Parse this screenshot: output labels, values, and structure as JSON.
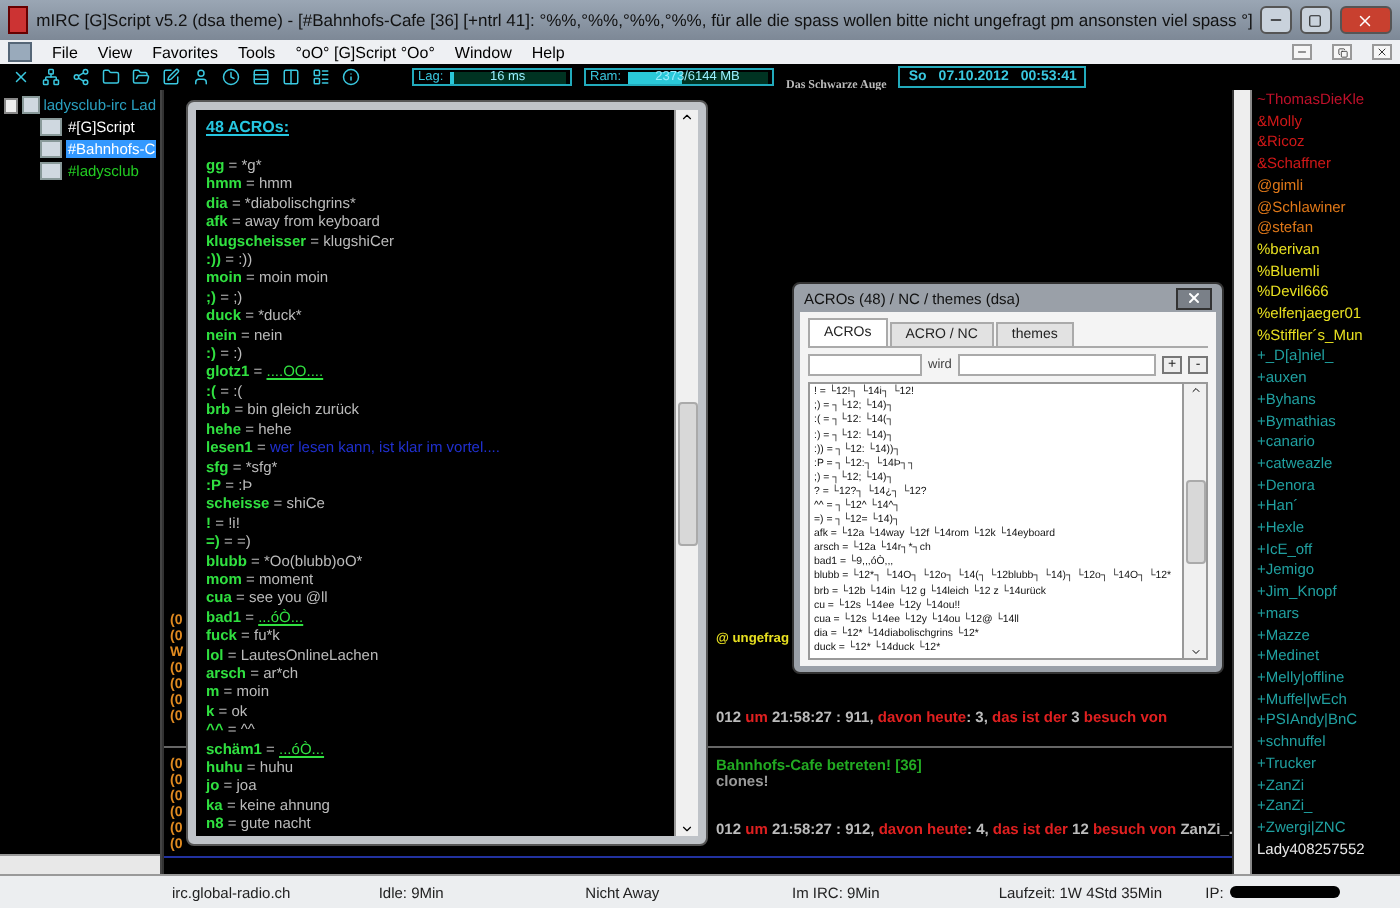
{
  "window": {
    "title": "mIRC [G]Script v5.2 (dsa theme) - [#Bahnhofs-Cafe [36] [+ntrl 41]: °%%,°%%,°%%,°%%, für alle die spass wollen bitte nicht ungefragt pm ansonsten viel spass °]"
  },
  "menu": [
    "File",
    "View",
    "Favorites",
    "Tools",
    "°oO° [G]Script °Oo°",
    "Window",
    "Help"
  ],
  "toolbar": {
    "lag": {
      "label": "Lag:",
      "reading": "16 ms",
      "level": 0.04
    },
    "ram": {
      "label": "Ram:",
      "reading": "2373/6144 MB",
      "level": 0.39
    },
    "banner": "Das Schwarze Auge",
    "clock": {
      "day": "So",
      "date": "07.10.2012",
      "time": "00:53:41"
    }
  },
  "tree": {
    "label": "ladysclub-irc Lad",
    "children": [
      {
        "label": "#[G]Script",
        "selected": false,
        "color": "#ffffff"
      },
      {
        "label": "#Bahnhofs-C",
        "selected": true
      },
      {
        "label": "#ladysclub",
        "selected": false,
        "color": "#22cc22"
      }
    ]
  },
  "chat": {
    "upper": [
      {
        "left": "(0"
      },
      {
        "left": "(0",
        "segments": [
          {
            "text": "@ ungefrag",
            "kind": "topic"
          }
        ]
      },
      {
        "left": "W"
      },
      {
        "left": "(0"
      },
      {
        "left": "(0"
      },
      {
        "left": "(0"
      },
      {
        "left": "(0",
        "segments": [
          {
            "text": "012 ",
            "kind": "plain"
          },
          {
            "text": "um",
            "kind": "hl"
          },
          {
            "text": " 21:58:27 : 911, ",
            "kind": "plain"
          },
          {
            "text": "davon heute",
            "kind": "hl"
          },
          {
            "text": ": 3, ",
            "kind": "plain"
          },
          {
            "text": "das ist der",
            "kind": "hl"
          },
          {
            "text": " 3 ",
            "kind": "plain"
          },
          {
            "text": "besuch von",
            "kind": "hl"
          }
        ]
      }
    ],
    "lower": [
      {
        "left": "(0",
        "segments": [
          {
            "text": "Bahnhofs-Cafe betreten! [36]",
            "kind": "join"
          }
        ]
      },
      {
        "left": "(0",
        "segments": [
          {
            "text": "clones!",
            "kind": "dim"
          }
        ]
      },
      {
        "left": "(0"
      },
      {
        "left": "(0"
      },
      {
        "left": "(0",
        "segments": [
          {
            "text": "012 ",
            "kind": "plain"
          },
          {
            "text": "um",
            "kind": "hl"
          },
          {
            "text": " 21:58:27 : 912, ",
            "kind": "plain"
          },
          {
            "text": "davon heute",
            "kind": "hl"
          },
          {
            "text": ": 4, ",
            "kind": "plain"
          },
          {
            "text": "das ist der",
            "kind": "hl"
          },
          {
            "text": " 12 ",
            "kind": "plain"
          },
          {
            "text": "besuch von",
            "kind": "hl"
          },
          {
            "text": " ZanZi_.",
            "kind": "plain"
          }
        ]
      },
      {
        "left": "(0"
      }
    ]
  },
  "nicklist": [
    {
      "nick": "~ThomasDieKle",
      "color": "#c0102a"
    },
    {
      "nick": "&Molly",
      "color": "#d01818"
    },
    {
      "nick": "&Ricoz",
      "color": "#d01818"
    },
    {
      "nick": "&Schaffner",
      "color": "#d01818"
    },
    {
      "nick": "@gimli",
      "color": "#e07818"
    },
    {
      "nick": "@Schlawiner",
      "color": "#e07818"
    },
    {
      "nick": "@stefan",
      "color": "#e07818"
    },
    {
      "nick": "%berivan",
      "color": "#e8e020"
    },
    {
      "nick": "%Bluemli",
      "color": "#e8e020"
    },
    {
      "nick": "%Devil666",
      "color": "#e8e020"
    },
    {
      "nick": "%elfenjaeger01",
      "color": "#e8e020"
    },
    {
      "nick": "%Stiffler´s_Mun",
      "color": "#e8e020"
    },
    {
      "nick": "+_D[a]niel_",
      "color": "#20a0a0"
    },
    {
      "nick": "+auxen",
      "color": "#20a0a0"
    },
    {
      "nick": "+Byhans",
      "color": "#20a0a0"
    },
    {
      "nick": "+Bymathias",
      "color": "#20a0a0"
    },
    {
      "nick": "+canario",
      "color": "#20a0a0"
    },
    {
      "nick": "+catweazle",
      "color": "#20a0a0"
    },
    {
      "nick": "+Denora",
      "color": "#20a0a0"
    },
    {
      "nick": "+Han´",
      "color": "#20a0a0"
    },
    {
      "nick": "+Hexle",
      "color": "#20a0a0"
    },
    {
      "nick": "+IcE_off",
      "color": "#20a0a0"
    },
    {
      "nick": "+Jemigo",
      "color": "#20a0a0"
    },
    {
      "nick": "+Jim_Knopf",
      "color": "#20a0a0"
    },
    {
      "nick": "+mars",
      "color": "#20a0a0"
    },
    {
      "nick": "+Mazze",
      "color": "#20a0a0"
    },
    {
      "nick": "+Medinet",
      "color": "#20a0a0"
    },
    {
      "nick": "+Melly|offline",
      "color": "#20a0a0"
    },
    {
      "nick": "+Muffel|wEch",
      "color": "#20a0a0"
    },
    {
      "nick": "+PSIAndy|BnC",
      "color": "#20a0a0"
    },
    {
      "nick": "+schnuffel",
      "color": "#20a0a0"
    },
    {
      "nick": "+Trucker",
      "color": "#20a0a0"
    },
    {
      "nick": "+ZanZi",
      "color": "#20a0a0"
    },
    {
      "nick": "+ZanZi_",
      "color": "#20a0a0"
    },
    {
      "nick": "+Zwergi|ZNC",
      "color": "#20a0a0"
    },
    {
      "nick": "Lady408257552",
      "color": "#e8e8e8"
    }
  ],
  "acro_window": {
    "heading": "48 ACROs:",
    "entries": [
      {
        "key": "gg",
        "sep": "=",
        "value": "*g*",
        "kind": "plain"
      },
      {
        "key": "hmm",
        "sep": "=",
        "value": "hmm",
        "kind": "plain"
      },
      {
        "key": "dia",
        "sep": "=",
        "value": "*diabolischgrins*",
        "kind": "plain"
      },
      {
        "key": "afk",
        "sep": "=",
        "value": "away from keyboard",
        "kind": "plain"
      },
      {
        "key": "klugscheisser",
        "sep": "=",
        "value": "klugshiCer",
        "kind": "plain"
      },
      {
        "key": ":))",
        "sep": "=",
        "value": ":))",
        "kind": "plain"
      },
      {
        "key": "moin",
        "sep": "=",
        "value": "moin moin",
        "kind": "plain"
      },
      {
        "key": ";)",
        "sep": "=",
        "value": ";)",
        "kind": "plain"
      },
      {
        "key": "duck",
        "sep": "=",
        "value": "*duck*",
        "kind": "plain"
      },
      {
        "key": "nein",
        "sep": "=",
        "value": "nein",
        "kind": "plain"
      },
      {
        "key": ":)",
        "sep": "=",
        "value": ":)",
        "kind": "plain"
      },
      {
        "key": "glotz1",
        "sep": "=",
        "value": "....OO....",
        "kind": "green"
      },
      {
        "key": ":(",
        "sep": "=",
        "value": ":(",
        "kind": "plain"
      },
      {
        "key": "brb",
        "sep": "=",
        "value": "bin gleich zurück",
        "kind": "plain"
      },
      {
        "key": "hehe",
        "sep": "=",
        "value": "hehe",
        "kind": "plain"
      },
      {
        "key": "lesen1",
        "sep": "=",
        "value": "wer lesen kann, ist klar im vortel....",
        "kind": "blue"
      },
      {
        "key": "sfg",
        "sep": "=",
        "value": "*sfg*",
        "kind": "plain"
      },
      {
        "key": ":P",
        "sep": "=",
        "value": ":Þ",
        "kind": "plain"
      },
      {
        "key": "scheisse",
        "sep": "=",
        "value": "shiCe",
        "kind": "plain"
      },
      {
        "key": "!",
        "sep": "=",
        "value": "!i!",
        "kind": "plain"
      },
      {
        "key": "=)",
        "sep": "=",
        "value": "=)",
        "kind": "plain"
      },
      {
        "key": "blubb",
        "sep": "=",
        "value": "*Oo(blubb)oO*",
        "kind": "plain"
      },
      {
        "key": "mom",
        "sep": "=",
        "value": "moment",
        "kind": "plain"
      },
      {
        "key": "cua",
        "sep": "=",
        "value": "see you @ll",
        "kind": "plain"
      },
      {
        "key": "bad1",
        "sep": "=",
        "value": "...óÒ...",
        "kind": "green"
      },
      {
        "key": "fuck",
        "sep": "=",
        "value": "fu*k",
        "kind": "plain"
      },
      {
        "key": "lol",
        "sep": "=",
        "value": "LautesOnlineLachen",
        "kind": "plain"
      },
      {
        "key": "arsch",
        "sep": "=",
        "value": "ar*ch",
        "kind": "plain"
      },
      {
        "key": "m",
        "sep": "=",
        "value": "moin",
        "kind": "plain"
      },
      {
        "key": "k",
        "sep": "=",
        "value": "ok",
        "kind": "plain"
      },
      {
        "key": "^^",
        "sep": "=",
        "value": "^^",
        "kind": "plain"
      },
      {
        "key": "schäm1",
        "sep": "=",
        "value": "...óÒ...",
        "kind": "green"
      },
      {
        "key": "huhu",
        "sep": "=",
        "value": "huhu",
        "kind": "plain"
      },
      {
        "key": "jo",
        "sep": "=",
        "value": "joa",
        "kind": "plain"
      },
      {
        "key": "ka",
        "sep": "=",
        "value": "keine ahnung",
        "kind": "plain"
      },
      {
        "key": "n8",
        "sep": "=",
        "value": "gute nacht",
        "kind": "plain"
      }
    ]
  },
  "acro_dialog": {
    "title": "ACROs (48) / NC / themes (dsa)",
    "tabs": [
      {
        "label": "ACROs",
        "selected": true
      },
      {
        "label": "ACRO / NC",
        "selected": false
      },
      {
        "label": "themes",
        "selected": false
      }
    ],
    "field_label": "wird",
    "buttons": [
      "+",
      "-"
    ],
    "lines": [
      "! = └12!┐ └14i┐ └12!",
      ";) = ┐└12; └14)┐",
      ":( = ┐└12: └14(┐",
      ":) = ┐└12: └14)┐",
      ":)) = ┐└12: └14))┐",
      ":P = ┐└12:┐ └14Þ┐┐",
      ";) = ┐└12; └14)┐",
      "? = └12?┐ └14¿┐ └12?",
      "^^ = ┐└12^ └14^┐",
      "=) = ┐└12= └14)┐",
      "afk = └12a └14way └12f └14rom └12k └14eyboard",
      "arsch = └12a └14r┐*┐ch",
      "bad1 = └9,,,óÒ,,,",
      "blubb = └12*┐ └14O┐ └12o┐ └14(┐ └12blubb┐ └14)┐ └12o┐ └14O┐ └12*",
      "brb = └12b └14in └12 g └14leich └12 z └14urück",
      "cu = └12s └14ee └12y └14ou!!",
      "cua = └12s └14ee └12y └14ou └12@ └14ll",
      "dia = └12* └14diabolischgrins └12*",
      "duck = └12* └14duck └12*"
    ]
  },
  "status_bar": {
    "items": [
      "irc.global-radio.ch",
      "Idle: 9Min",
      "Nicht Away",
      "Im IRC: 9Min",
      "Laufzeit: 1W 4Std 35Min"
    ],
    "ip_label": "IP:"
  }
}
